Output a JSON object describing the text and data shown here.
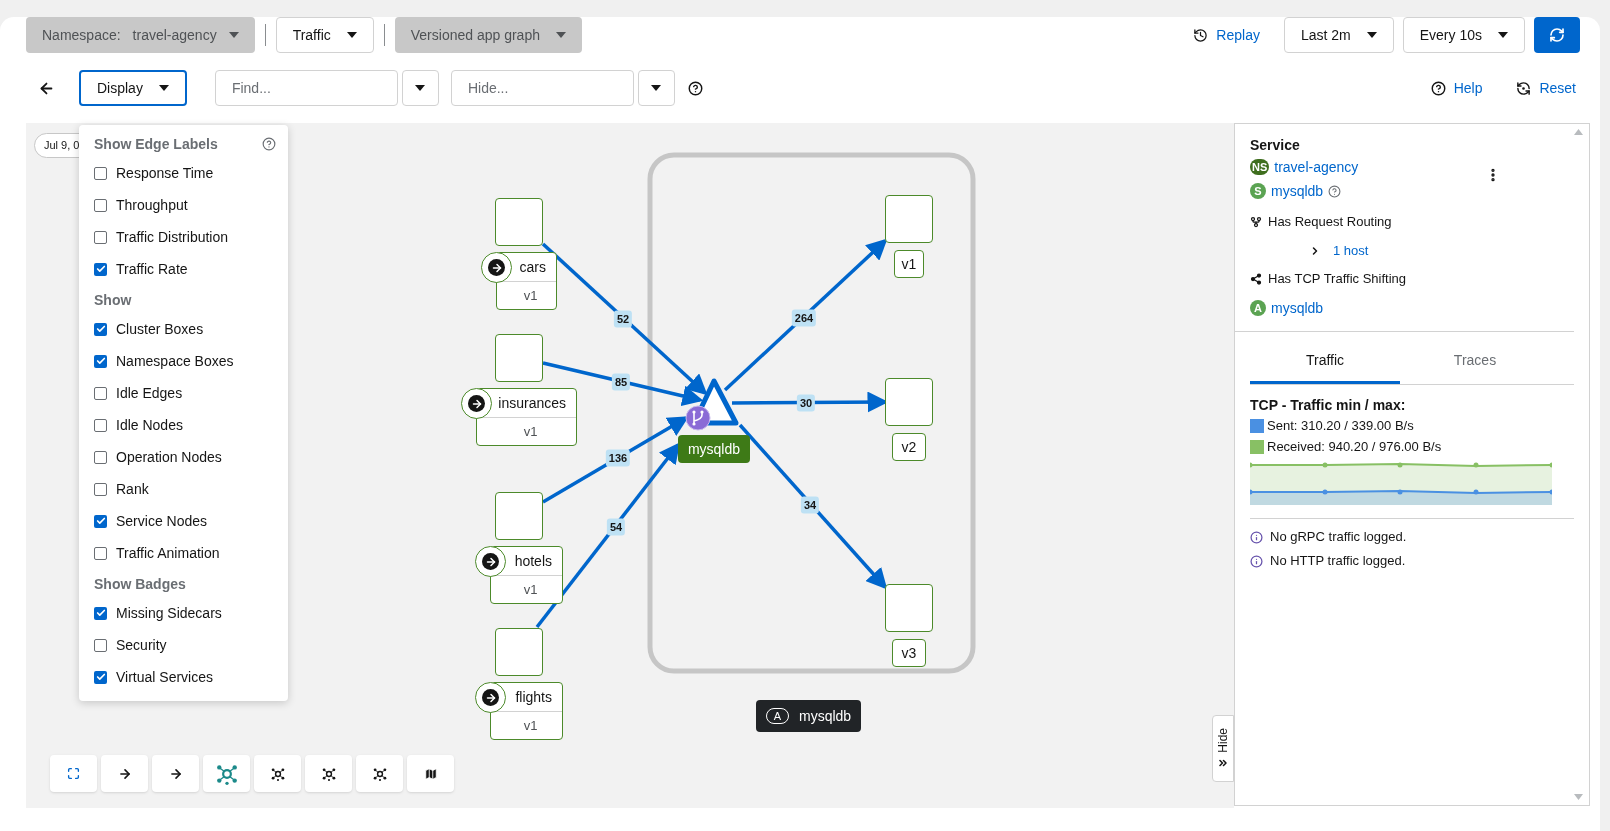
{
  "toolbar": {
    "namespace_label": "Namespace:",
    "namespace": "travel-agency",
    "traffic": "Traffic",
    "graph_type": "Versioned app graph",
    "replay": "Replay",
    "duration": "Last 2m",
    "refresh_interval": "Every 10s"
  },
  "secondary": {
    "display": "Display",
    "find_placeholder": "Find...",
    "hide_placeholder": "Hide...",
    "help": "Help",
    "reset": "Reset"
  },
  "display_menu": {
    "sections": [
      {
        "title": "Show Edge Labels",
        "help": true,
        "items": [
          {
            "label": "Response Time",
            "checked": false
          },
          {
            "label": "Throughput",
            "checked": false
          },
          {
            "label": "Traffic Distribution",
            "checked": false
          },
          {
            "label": "Traffic Rate",
            "checked": true
          }
        ]
      },
      {
        "title": "Show",
        "help": false,
        "items": [
          {
            "label": "Cluster Boxes",
            "checked": true
          },
          {
            "label": "Namespace Boxes",
            "checked": true
          },
          {
            "label": "Idle Edges",
            "checked": false
          },
          {
            "label": "Idle Nodes",
            "checked": false
          },
          {
            "label": "Operation Nodes",
            "checked": false
          },
          {
            "label": "Rank",
            "checked": false
          },
          {
            "label": "Service Nodes",
            "checked": true
          },
          {
            "label": "Traffic Animation",
            "checked": false
          }
        ]
      },
      {
        "title": "Show Badges",
        "help": false,
        "items": [
          {
            "label": "Missing Sidecars",
            "checked": true
          },
          {
            "label": "Security",
            "checked": false
          },
          {
            "label": "Virtual Services",
            "checked": true
          }
        ]
      }
    ]
  },
  "graph": {
    "date": "Jul 9, 0",
    "source_nodes": [
      {
        "name": "cars",
        "version": "v1"
      },
      {
        "name": "insurances",
        "version": "v1"
      },
      {
        "name": "hotels",
        "version": "v1"
      },
      {
        "name": "flights",
        "version": "v1"
      }
    ],
    "service": {
      "name": "mysqldb",
      "routing_badge": true
    },
    "target_nodes": [
      {
        "version": "v1"
      },
      {
        "version": "v2"
      },
      {
        "version": "v3"
      }
    ],
    "edges": [
      {
        "label": "52"
      },
      {
        "label": "85"
      },
      {
        "label": "136"
      },
      {
        "label": "54"
      },
      {
        "label": "264"
      },
      {
        "label": "30"
      },
      {
        "label": "34"
      }
    ],
    "tooltip": {
      "badge": "A",
      "label": "mysqldb"
    },
    "hide_tab": "Hide"
  },
  "side_panel": {
    "title": "Service",
    "entities": [
      {
        "badge": "NS",
        "color": "#3e6e1e",
        "name": "travel-agency",
        "help": false
      },
      {
        "badge": "S",
        "color": "#5ba352",
        "name": "mysqldb",
        "help": true
      }
    ],
    "request_routing": "Has Request Routing",
    "hosts": "1 host",
    "traffic_shifting": "Has TCP Traffic Shifting",
    "app": {
      "badge": "A",
      "color": "#5ba352",
      "name": "mysqldb"
    },
    "tabs": [
      {
        "label": "Traffic",
        "selected": true
      },
      {
        "label": "Traces",
        "selected": false
      }
    ],
    "traffic_title": "TCP - Traffic min / max:",
    "legend": [
      {
        "label": "Sent: 310.20 / 339.00 B/s",
        "color": "#4a90e2"
      },
      {
        "label": "Received: 940.20 / 976.00 B/s",
        "color": "#88c064"
      }
    ],
    "notes": [
      "No gRPC traffic logged.",
      "No HTTP traffic logged."
    ]
  }
}
